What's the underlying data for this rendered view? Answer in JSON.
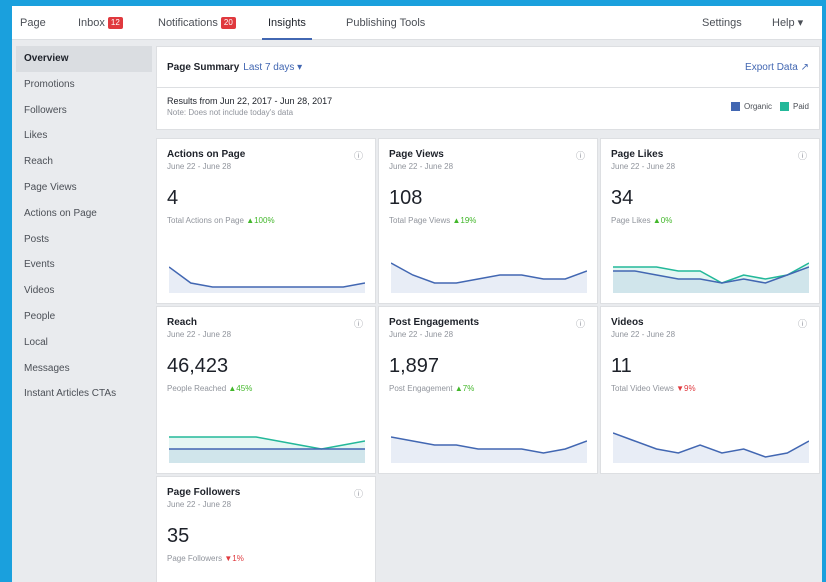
{
  "nav": {
    "page": "Page",
    "inbox": "Inbox",
    "inbox_badge": "12",
    "notifications": "Notifications",
    "notifications_badge": "20",
    "insights": "Insights",
    "publishing_tools": "Publishing Tools",
    "settings": "Settings",
    "help": "Help ▾"
  },
  "sidebar": {
    "items": [
      {
        "label": "Overview"
      },
      {
        "label": "Promotions"
      },
      {
        "label": "Followers"
      },
      {
        "label": "Likes"
      },
      {
        "label": "Reach"
      },
      {
        "label": "Page Views"
      },
      {
        "label": "Actions on Page"
      },
      {
        "label": "Posts"
      },
      {
        "label": "Events"
      },
      {
        "label": "Videos"
      },
      {
        "label": "People"
      },
      {
        "label": "Local"
      },
      {
        "label": "Messages"
      },
      {
        "label": "Instant Articles CTAs"
      }
    ]
  },
  "summary": {
    "title": "Page Summary",
    "range": "Last 7 days ▾",
    "export": "Export Data ↗"
  },
  "results": {
    "line1": "Results from Jun 22, 2017 - Jun 28, 2017",
    "line2": "Note: Does not include today's data"
  },
  "legend": {
    "organic": "Organic",
    "paid": "Paid",
    "organic_color": "#4267b2",
    "paid_color": "#23b899"
  },
  "cards": [
    {
      "title": "Actions on Page",
      "date": "June 22 - June 28",
      "value": "4",
      "desc": "Total Actions on Page",
      "change": "▲100%",
      "dir": "up",
      "organic": [
        6,
        2,
        1,
        1,
        1,
        1,
        1,
        1,
        1,
        2
      ],
      "paid": null
    },
    {
      "title": "Page Views",
      "date": "June 22 - June 28",
      "value": "108",
      "desc": "Total Page Views",
      "change": "▲19%",
      "dir": "up",
      "organic": [
        7,
        4,
        2,
        2,
        3,
        4,
        4,
        3,
        3,
        5
      ],
      "paid": null
    },
    {
      "title": "Page Likes",
      "date": "June 22 - June 28",
      "value": "34",
      "desc": "Page Likes",
      "change": "▲0%",
      "dir": "up",
      "organic": [
        5,
        5,
        4,
        3,
        3,
        2,
        3,
        2,
        4,
        6
      ],
      "paid": [
        6,
        6,
        6,
        5,
        5,
        2,
        4,
        3,
        4,
        7
      ]
    },
    {
      "title": "Reach",
      "date": "June 22 - June 28",
      "value": "46,423",
      "desc": "People Reached",
      "change": "▲45%",
      "dir": "up",
      "organic": [
        3,
        3,
        3,
        3,
        3,
        3,
        3,
        3,
        3,
        3
      ],
      "paid": [
        6,
        6,
        6,
        6,
        6,
        5,
        4,
        3,
        4,
        5
      ]
    },
    {
      "title": "Post Engagements",
      "date": "June 22 - June 28",
      "value": "1,897",
      "desc": "Post Engagement",
      "change": "▲7%",
      "dir": "up",
      "organic": [
        6,
        5,
        4,
        4,
        3,
        3,
        3,
        2,
        3,
        5
      ],
      "paid": null
    },
    {
      "title": "Videos",
      "date": "June 22 - June 28",
      "value": "11",
      "desc": "Total Video Views",
      "change": "▼9%",
      "dir": "down",
      "organic": [
        7,
        5,
        3,
        2,
        4,
        2,
        3,
        1,
        2,
        5
      ],
      "paid": null
    },
    {
      "title": "Page Followers",
      "date": "June 22 - June 28",
      "value": "35",
      "desc": "Page Followers",
      "change": "▼1%",
      "dir": "down",
      "organic": null,
      "paid": null
    }
  ]
}
